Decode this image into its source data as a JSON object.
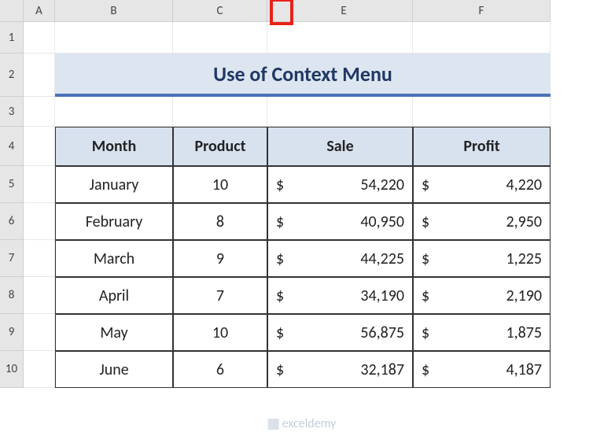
{
  "columns": [
    "A",
    "B",
    "C",
    "E",
    "F"
  ],
  "rows": [
    "1",
    "2",
    "3",
    "4",
    "5",
    "6",
    "7",
    "8",
    "9",
    "10"
  ],
  "title": "Use of Context Menu",
  "table": {
    "headers": {
      "month": "Month",
      "product": "Product",
      "sale": "Sale",
      "profit": "Profit"
    },
    "rows": [
      {
        "month": "January",
        "product": "10",
        "sale": "54,220",
        "profit": "4,220"
      },
      {
        "month": "February",
        "product": "8",
        "sale": "40,950",
        "profit": "2,950"
      },
      {
        "month": "March",
        "product": "9",
        "sale": "44,225",
        "profit": "1,225"
      },
      {
        "month": "April",
        "product": "7",
        "sale": "34,190",
        "profit": "2,190"
      },
      {
        "month": "May",
        "product": "10",
        "sale": "56,875",
        "profit": "1,875"
      },
      {
        "month": "June",
        "product": "6",
        "sale": "32,187",
        "profit": "4,187"
      }
    ]
  },
  "currency": "$",
  "watermark": "exceldemy",
  "chart_data": {
    "type": "table",
    "title": "Use of Context Menu",
    "columns": [
      "Month",
      "Product",
      "Sale",
      "Profit"
    ],
    "rows": [
      [
        "January",
        10,
        54220,
        4220
      ],
      [
        "February",
        8,
        40950,
        2950
      ],
      [
        "March",
        9,
        44225,
        1225
      ],
      [
        "April",
        7,
        34190,
        2190
      ],
      [
        "May",
        10,
        56875,
        1875
      ],
      [
        "June",
        6,
        32187,
        4187
      ]
    ]
  }
}
